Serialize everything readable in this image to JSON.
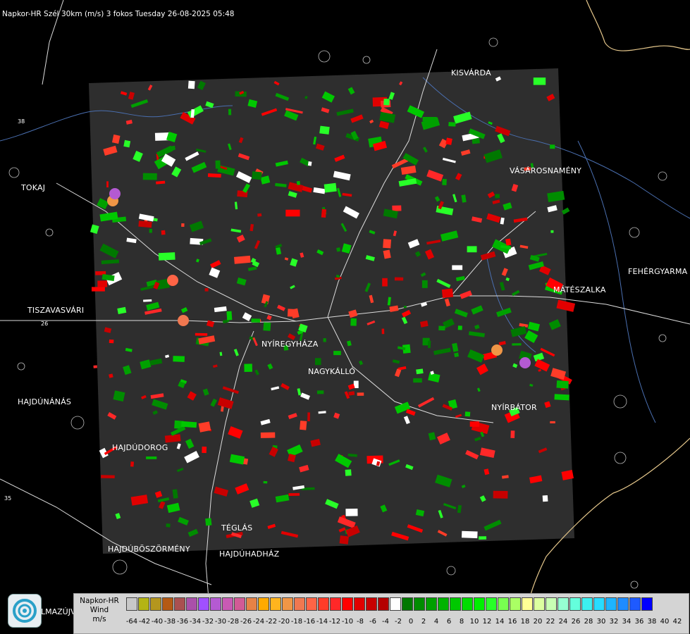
{
  "title": "Napkor-HR Szél 30km (m/s) 3 fokos Tuesday 26-08-2025 05:48",
  "towns": [
    {
      "id": "kisvarda",
      "name": "KISVÁRDA"
    },
    {
      "id": "vasarosnameny",
      "name": "VÁSÁROSNAMÉNY"
    },
    {
      "id": "tokaj",
      "name": "TOKAJ"
    },
    {
      "id": "fehergyarmat",
      "name": "FEHÉRGYARMA"
    },
    {
      "id": "mateszalka",
      "name": "MÁTÉSZALKA"
    },
    {
      "id": "tiszavasvari",
      "name": "TISZAVASVÁRI"
    },
    {
      "id": "nyiregyhaza",
      "name": "NYÍREGYHÁZA"
    },
    {
      "id": "nagykallo",
      "name": "NAGYKÁLLÓ"
    },
    {
      "id": "hajdunanas",
      "name": "HAJDÚNÁNÁS"
    },
    {
      "id": "nyirbator",
      "name": "NYÍRBÁTOR"
    },
    {
      "id": "hajdudorog",
      "name": "HAJDÚDOROG"
    },
    {
      "id": "teglas",
      "name": "TÉGLÁS"
    },
    {
      "id": "hajduboszormeny",
      "name": "HAJDÚBÖSZÖRMÉNY"
    },
    {
      "id": "hajduhadhaz",
      "name": "HAJDÚHADHÁZ"
    },
    {
      "id": "balmazujvaros",
      "name": "LMAZÚJVÁR"
    }
  ],
  "road_numbers": [
    "38",
    "26",
    "35"
  ],
  "legend": {
    "line1": "Napkor-HR",
    "line2": "Wind",
    "unit": "m/s",
    "colors": [
      "#c8c8c8",
      "#b4b414",
      "#b4961e",
      "#b45a14",
      "#aa5050",
      "#aa50aa",
      "#a050ff",
      "#b45ad2",
      "#c85ab4",
      "#d25a96",
      "#e68246",
      "#ffaa00",
      "#ffb41e",
      "#f09646",
      "#f07850",
      "#ff6446",
      "#ff3c28",
      "#ff2828",
      "#ff0000",
      "#e10000",
      "#c80000",
      "#b40000",
      "#ffffff",
      "#007800",
      "#008c00",
      "#00a000",
      "#00b400",
      "#00c800",
      "#00dc00",
      "#00f000",
      "#28ff28",
      "#78ff50",
      "#aaff64",
      "#ffff96",
      "#dcffa0",
      "#c8ffb4",
      "#96ffd2",
      "#64ffdc",
      "#3cf0f0",
      "#28dcff",
      "#1eb4ff",
      "#1e8cff",
      "#1e5aff",
      "#0000ff"
    ],
    "ticks": [
      "-64",
      "-42",
      "-40",
      "-38",
      "-36",
      "-34",
      "-32",
      "-30",
      "-28",
      "-26",
      "-24",
      "-22",
      "-20",
      "-18",
      "-16",
      "-14",
      "-12",
      "-10",
      "-8",
      "-6",
      "-4",
      "-2",
      "0",
      "2",
      "4",
      "6",
      "8",
      "10",
      "12",
      "14",
      "16",
      "18",
      "20",
      "22",
      "24",
      "26",
      "28",
      "30",
      "32",
      "34",
      "36",
      "38",
      "40",
      "42"
    ]
  }
}
